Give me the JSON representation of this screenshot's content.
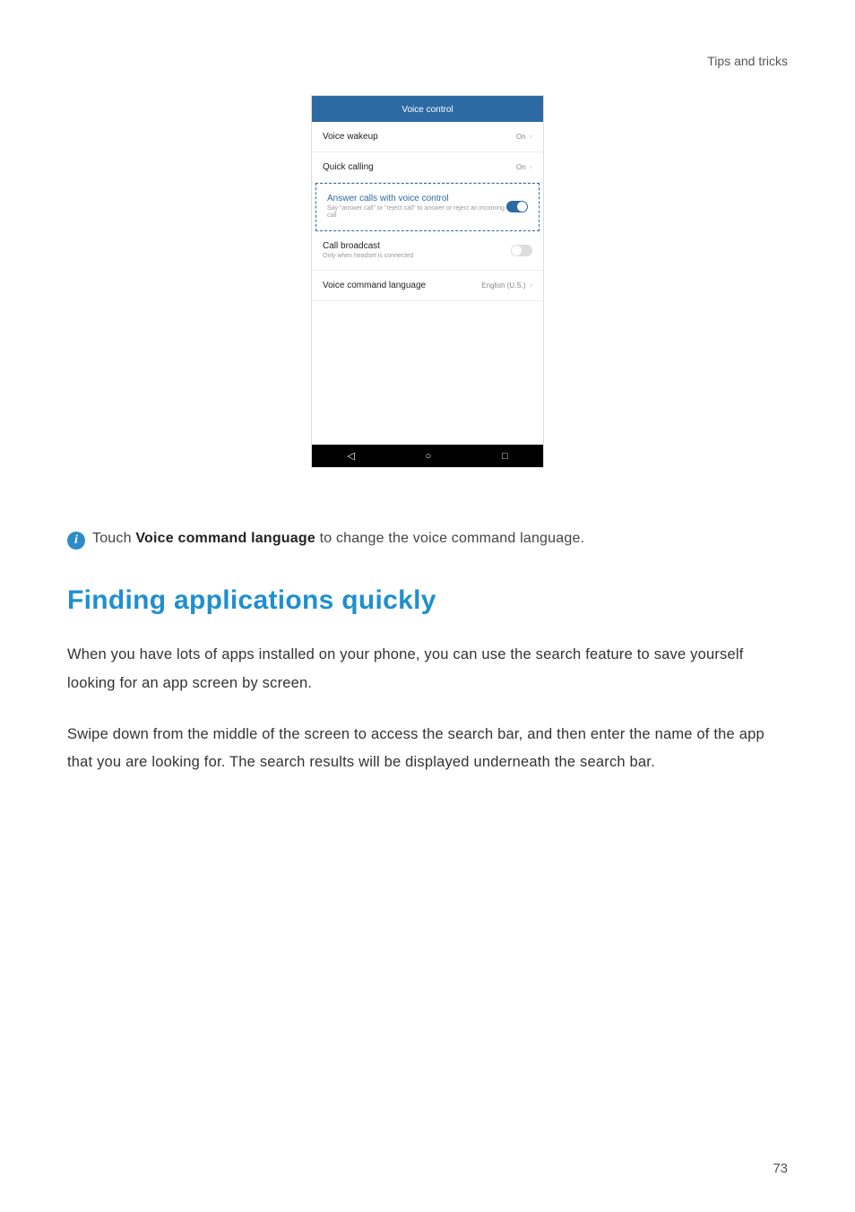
{
  "header": {
    "section": "Tips and tricks"
  },
  "phone": {
    "title": "Voice control",
    "rows": {
      "wakeup": {
        "label": "Voice wakeup",
        "value": "On"
      },
      "quick": {
        "label": "Quick calling",
        "value": "On"
      },
      "answer": {
        "label": "Answer calls with voice control",
        "sub": "Say \"answer call\" or \"reject call\" to answer or reject an incoming call"
      },
      "broadcast": {
        "label": "Call broadcast",
        "sub": "Only when headset is connected"
      },
      "lang": {
        "label": "Voice command language",
        "value": "English (U.S.)"
      }
    },
    "nav": {
      "back": "◁",
      "home": "○",
      "recent": "□"
    }
  },
  "tip": {
    "icon": "i",
    "prefix": "Touch ",
    "bold": "Voice command language",
    "suffix": " to change the voice command language."
  },
  "heading": "Finding applications quickly",
  "para1": "When you have lots of apps installed on your phone, you can use the search feature to save yourself looking for an app screen by screen.",
  "para2": "Swipe down from the middle of the screen to access the search bar, and then enter the name of the app that you are looking for. The search results will be displayed underneath the search bar.",
  "pageNumber": "73"
}
